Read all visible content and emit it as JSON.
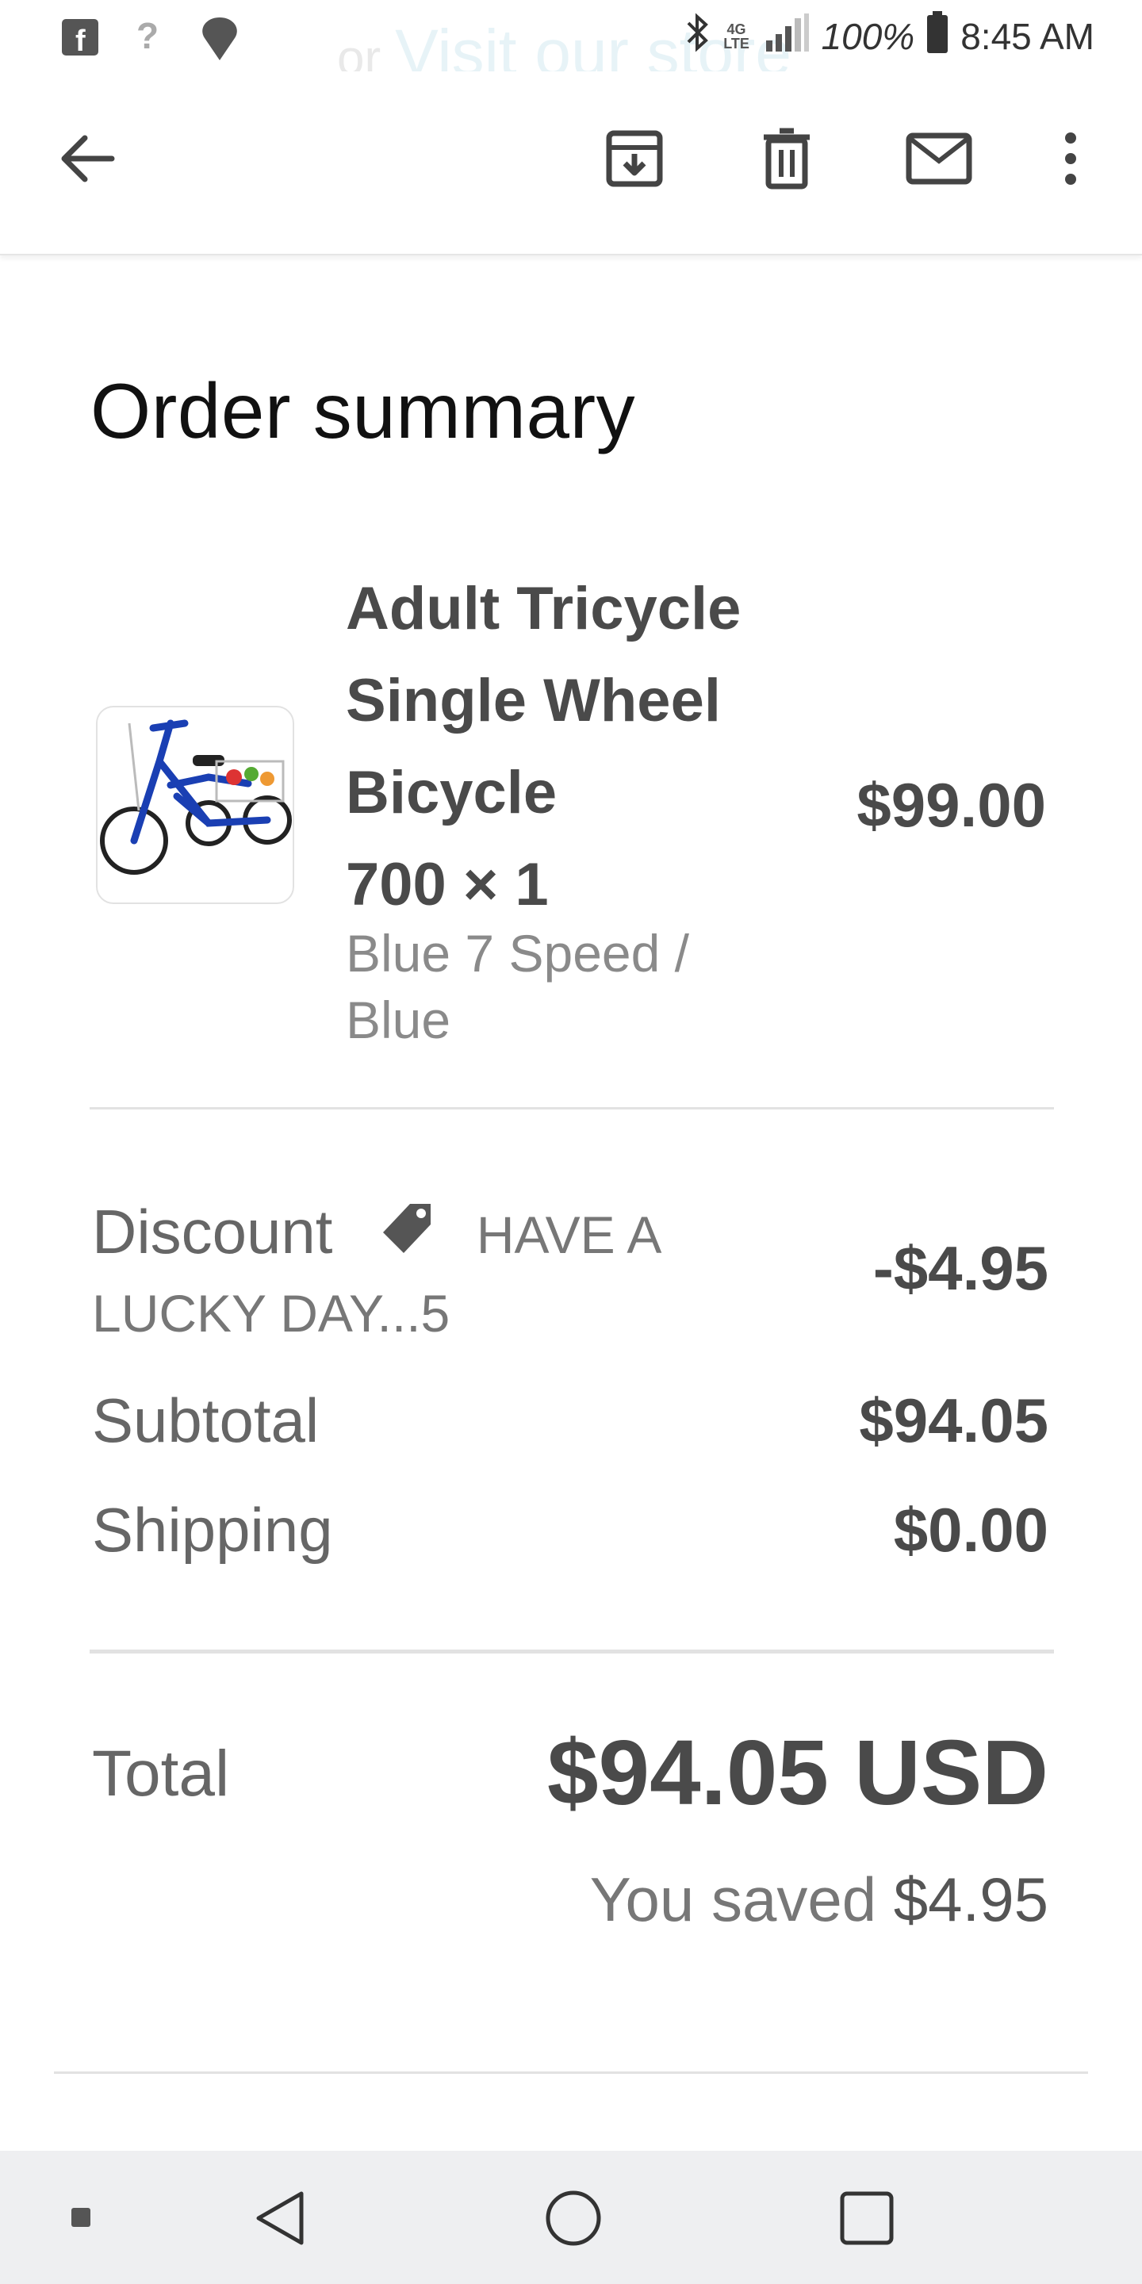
{
  "status_bar": {
    "ghost_or": "or",
    "ghost_link": "Visit our store",
    "battery": "100%",
    "time": "8:45 AM",
    "network": "4G LTE",
    "left_icons": [
      "facebook-icon",
      "unknown-icon",
      "notification-icon"
    ],
    "right_icons": [
      "bluetooth-icon",
      "network-icon",
      "signal-icon",
      "battery-icon"
    ]
  },
  "toolbar": {
    "icons": [
      "back-arrow-icon",
      "archive-icon",
      "delete-icon",
      "mail-icon",
      "more-icon"
    ]
  },
  "page": {
    "title": "Order summary"
  },
  "product": {
    "name_line1": "Adult Tricycle",
    "name_line2": "Single Wheel",
    "name_line3": "Bicycle",
    "quantity": "700 × 1",
    "variant_line1": "Blue 7 Speed /",
    "variant_line2": "Blue",
    "price": "$99.00"
  },
  "summary": {
    "discount_label": "Discount",
    "discount_code_line1": "HAVE A",
    "discount_code_line2": "LUCKY DAY...5",
    "discount_value": "-$4.95",
    "subtotal_label": "Subtotal",
    "subtotal_value": "$94.05",
    "shipping_label": "Shipping",
    "shipping_value": "$0.00"
  },
  "total": {
    "label": "Total",
    "value": "$94.05 USD",
    "saved_prefix": "You saved",
    "saved_amount": "$4.95"
  },
  "colors": {
    "accent_blue": "#1a3fb3",
    "text_dark": "#4a4a4a",
    "nav_bg": "#eeeff1"
  }
}
